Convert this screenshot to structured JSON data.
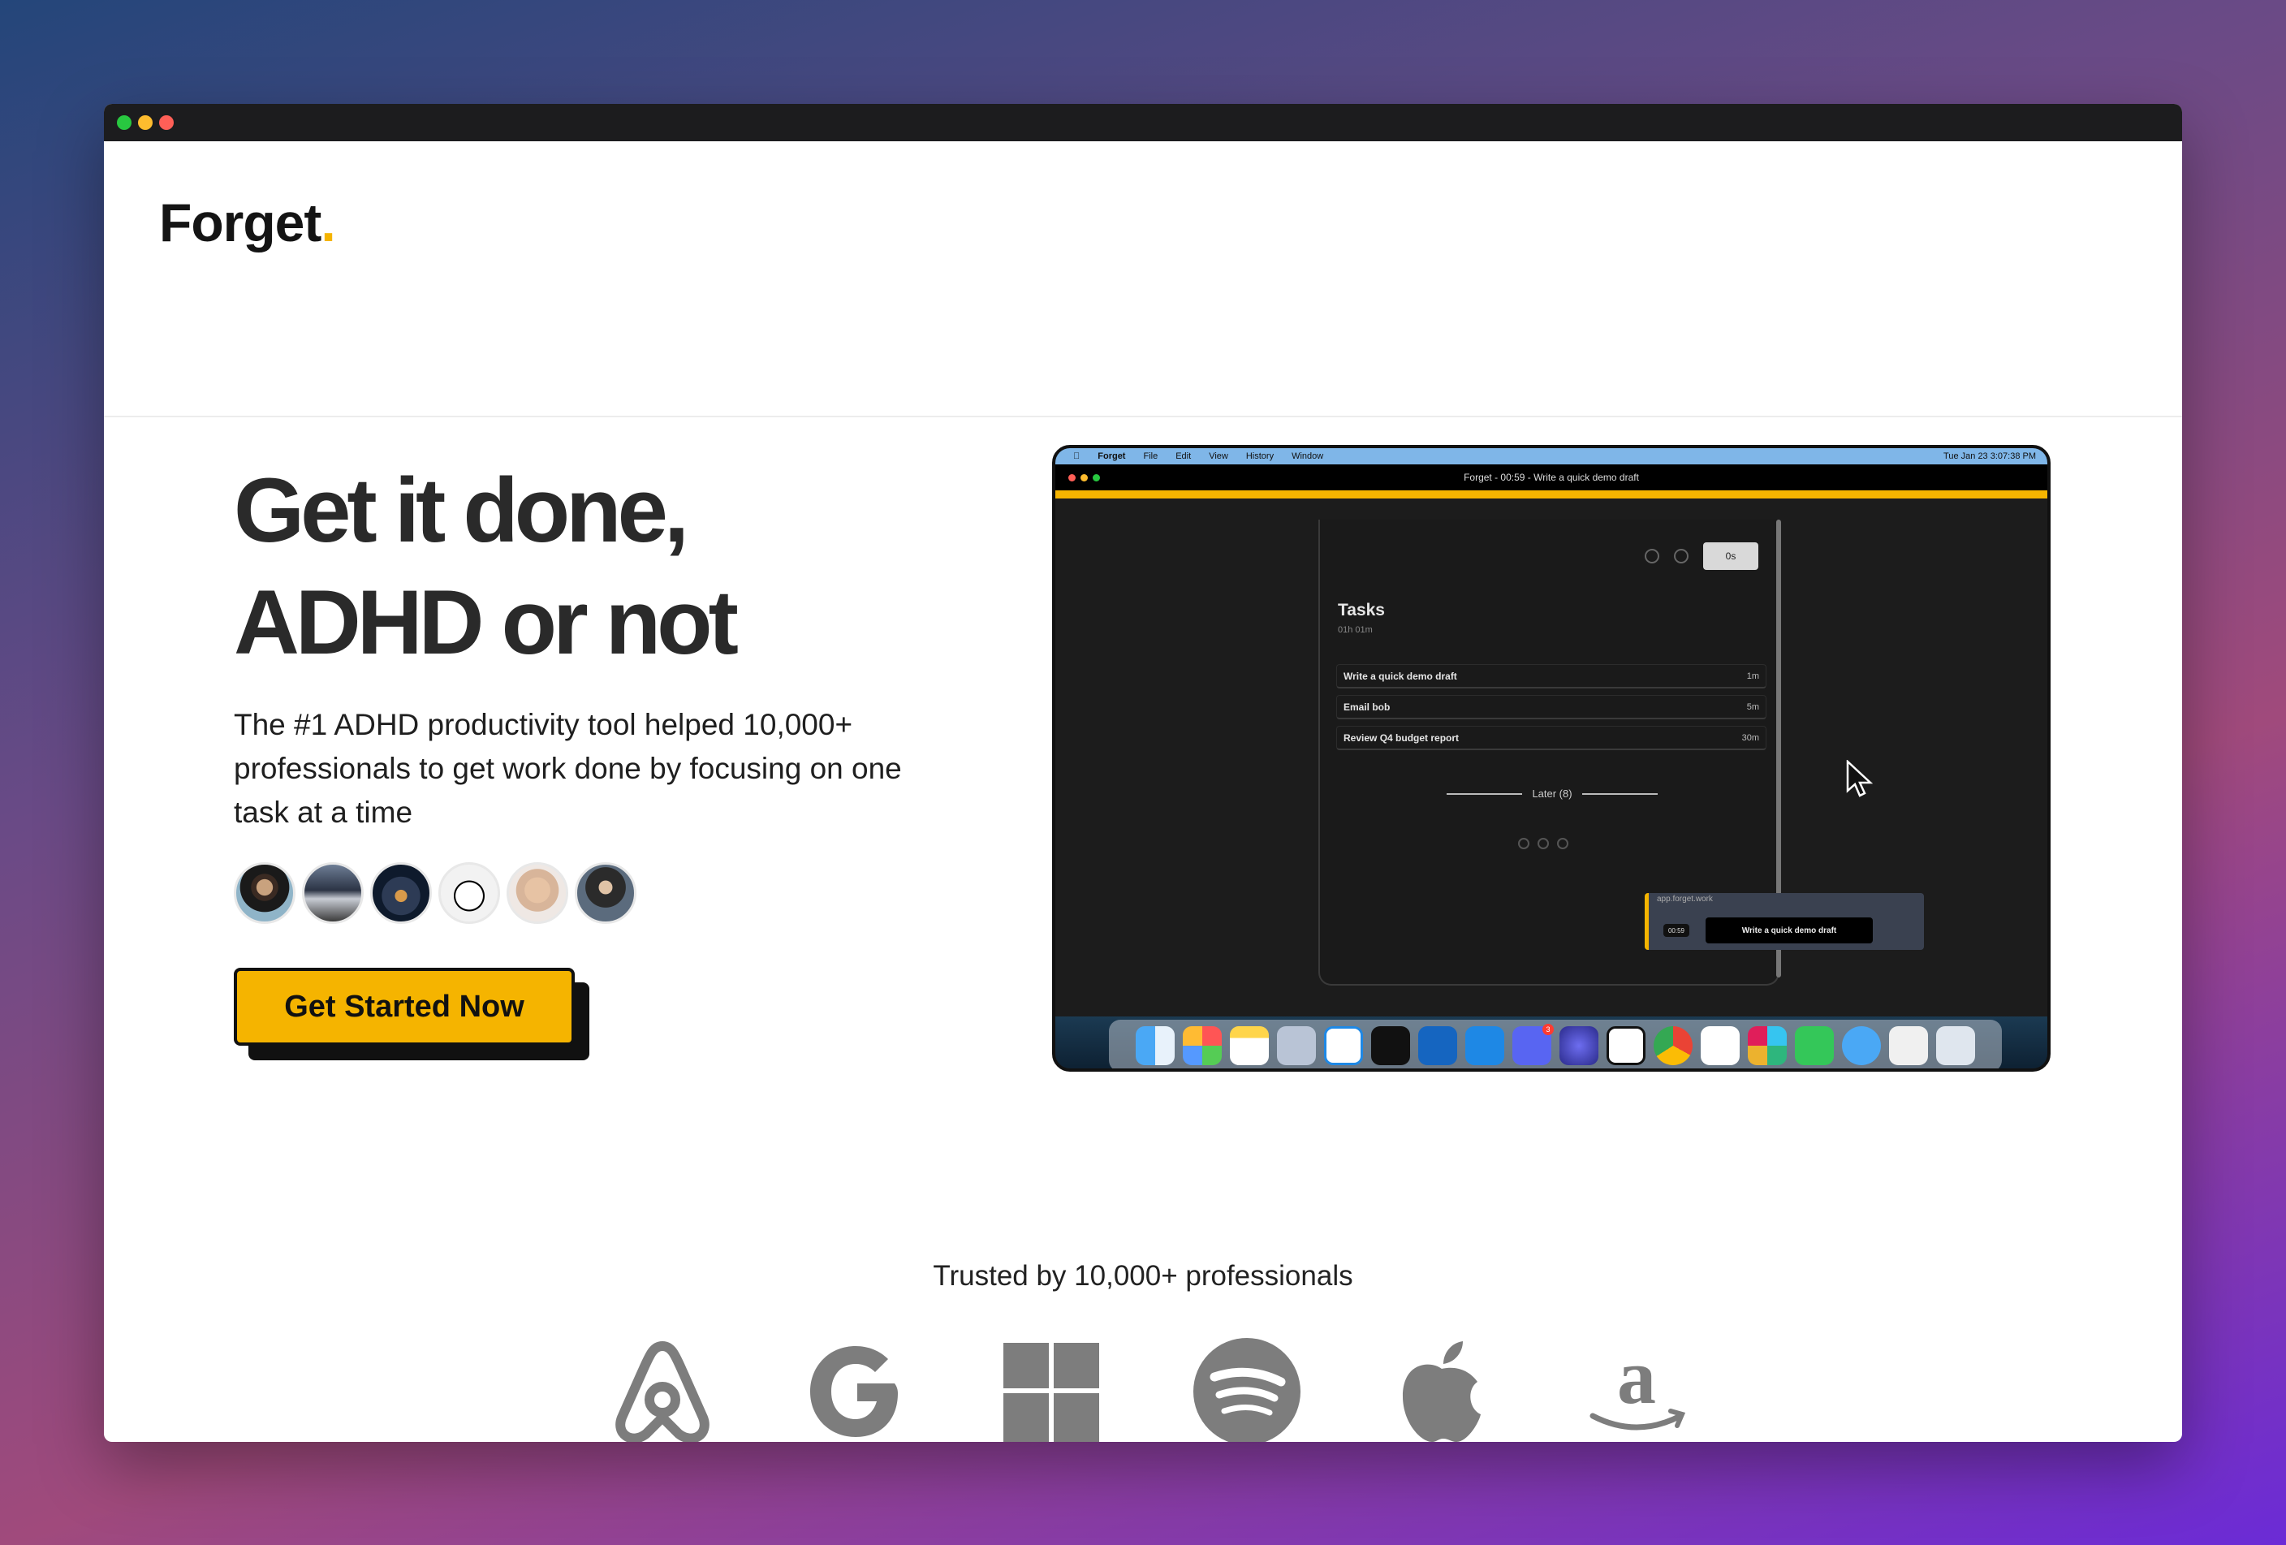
{
  "window": {
    "controls": [
      "close",
      "minimize",
      "maximize"
    ]
  },
  "nav": {
    "logo_text": "Forget",
    "logo_accent": ".",
    "accent_color": "#f5b400"
  },
  "hero": {
    "headline_line1": "Get it done,",
    "headline_line2": "ADHD or not",
    "subtitle": "The #1 ADHD productivity tool helped 10,000+ professionals to get work done by focusing on one task at a time",
    "avatars": [
      "user-1",
      "user-2",
      "user-3",
      "user-4",
      "user-5",
      "user-6"
    ],
    "cta_label": "Get Started Now"
  },
  "screenshot": {
    "menubar_app": "Forget",
    "menubar_items": [
      "File",
      "Edit",
      "View",
      "History",
      "Window"
    ],
    "menubar_clock": "Tue Jan 23  3:07:38 PM",
    "window_title": "Forget - 00:59 - Write a quick demo draft",
    "timer_pill": "0s",
    "tasks_title": "Tasks",
    "tasks_total": "01h 01m",
    "tasks": [
      {
        "name": "Write a quick demo draft",
        "duration": "1m"
      },
      {
        "name": "Email bob",
        "duration": "5m"
      },
      {
        "name": "Review Q4 budget report",
        "duration": "30m"
      }
    ],
    "later_label": "Later (8)",
    "mini_window": {
      "url": "app.forget.work",
      "time": "00:59",
      "task": "Write a quick demo draft"
    },
    "dock_badges": {
      "discord": "3"
    }
  },
  "trusted": {
    "heading": "Trusted by 10,000+ professionals",
    "brands": [
      "airbnb-icon",
      "google-icon",
      "microsoft-icon",
      "spotify-icon",
      "apple-icon",
      "amazon-icon"
    ]
  }
}
